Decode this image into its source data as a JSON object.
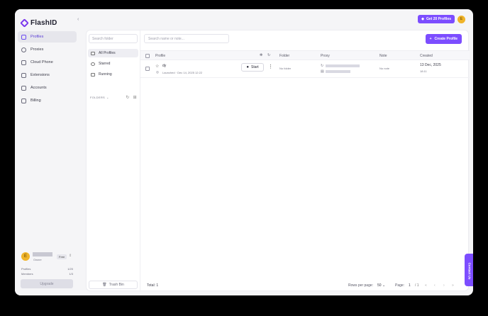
{
  "app": {
    "name": "FlashID"
  },
  "colors": {
    "accent": "#7c4dff",
    "avatar": "#f0b429"
  },
  "sidebar": {
    "items": [
      {
        "label": "Profiles",
        "icon": "profiles-icon",
        "active": true
      },
      {
        "label": "Proxies",
        "icon": "proxies-icon"
      },
      {
        "label": "Cloud Phone",
        "icon": "phone-icon"
      },
      {
        "label": "Extensions",
        "icon": "extensions-icon"
      },
      {
        "label": "Accounts",
        "icon": "accounts-icon"
      },
      {
        "label": "Billing",
        "icon": "billing-icon"
      }
    ],
    "user": {
      "initial": "E",
      "role": "Owner",
      "plan": "Free"
    },
    "stats": [
      {
        "label": "Profiles",
        "value": "1/20"
      },
      {
        "label": "Members",
        "value": "1/3"
      }
    ],
    "upgrade_label": "Upgrade"
  },
  "topbar": {
    "get_pro_label": "Get 20 Profiles",
    "avatar_initial": "E"
  },
  "folders": {
    "search_placeholder": "Search folder",
    "items": [
      {
        "label": "All Profiles",
        "active": true
      },
      {
        "label": "Starred"
      },
      {
        "label": "Running"
      }
    ],
    "section_label": "FOLDERS",
    "trash_label": "Trash Bin"
  },
  "profiles": {
    "search_placeholder": "Search name or note...",
    "create_label": "Create Profile",
    "columns": [
      "Profile",
      "Folder",
      "Proxy",
      "Note",
      "Created"
    ],
    "rows": [
      {
        "name": "dy",
        "launched": "Launched · Dec 14, 2025 12:22",
        "start_label": "Start",
        "folder": "No folder",
        "proxy_prefix": "↻",
        "note": "No note",
        "created_date": "13 Dec, 2025",
        "created_time": "18:11"
      }
    ],
    "total_label": "Total: 1"
  },
  "pagination": {
    "rows_per_page_label": "Rows per page:",
    "rows_per_page_value": "50",
    "page_label": "Page:",
    "current_page": "1",
    "total_pages": "/ 1"
  },
  "contact_label": "Contact Us"
}
